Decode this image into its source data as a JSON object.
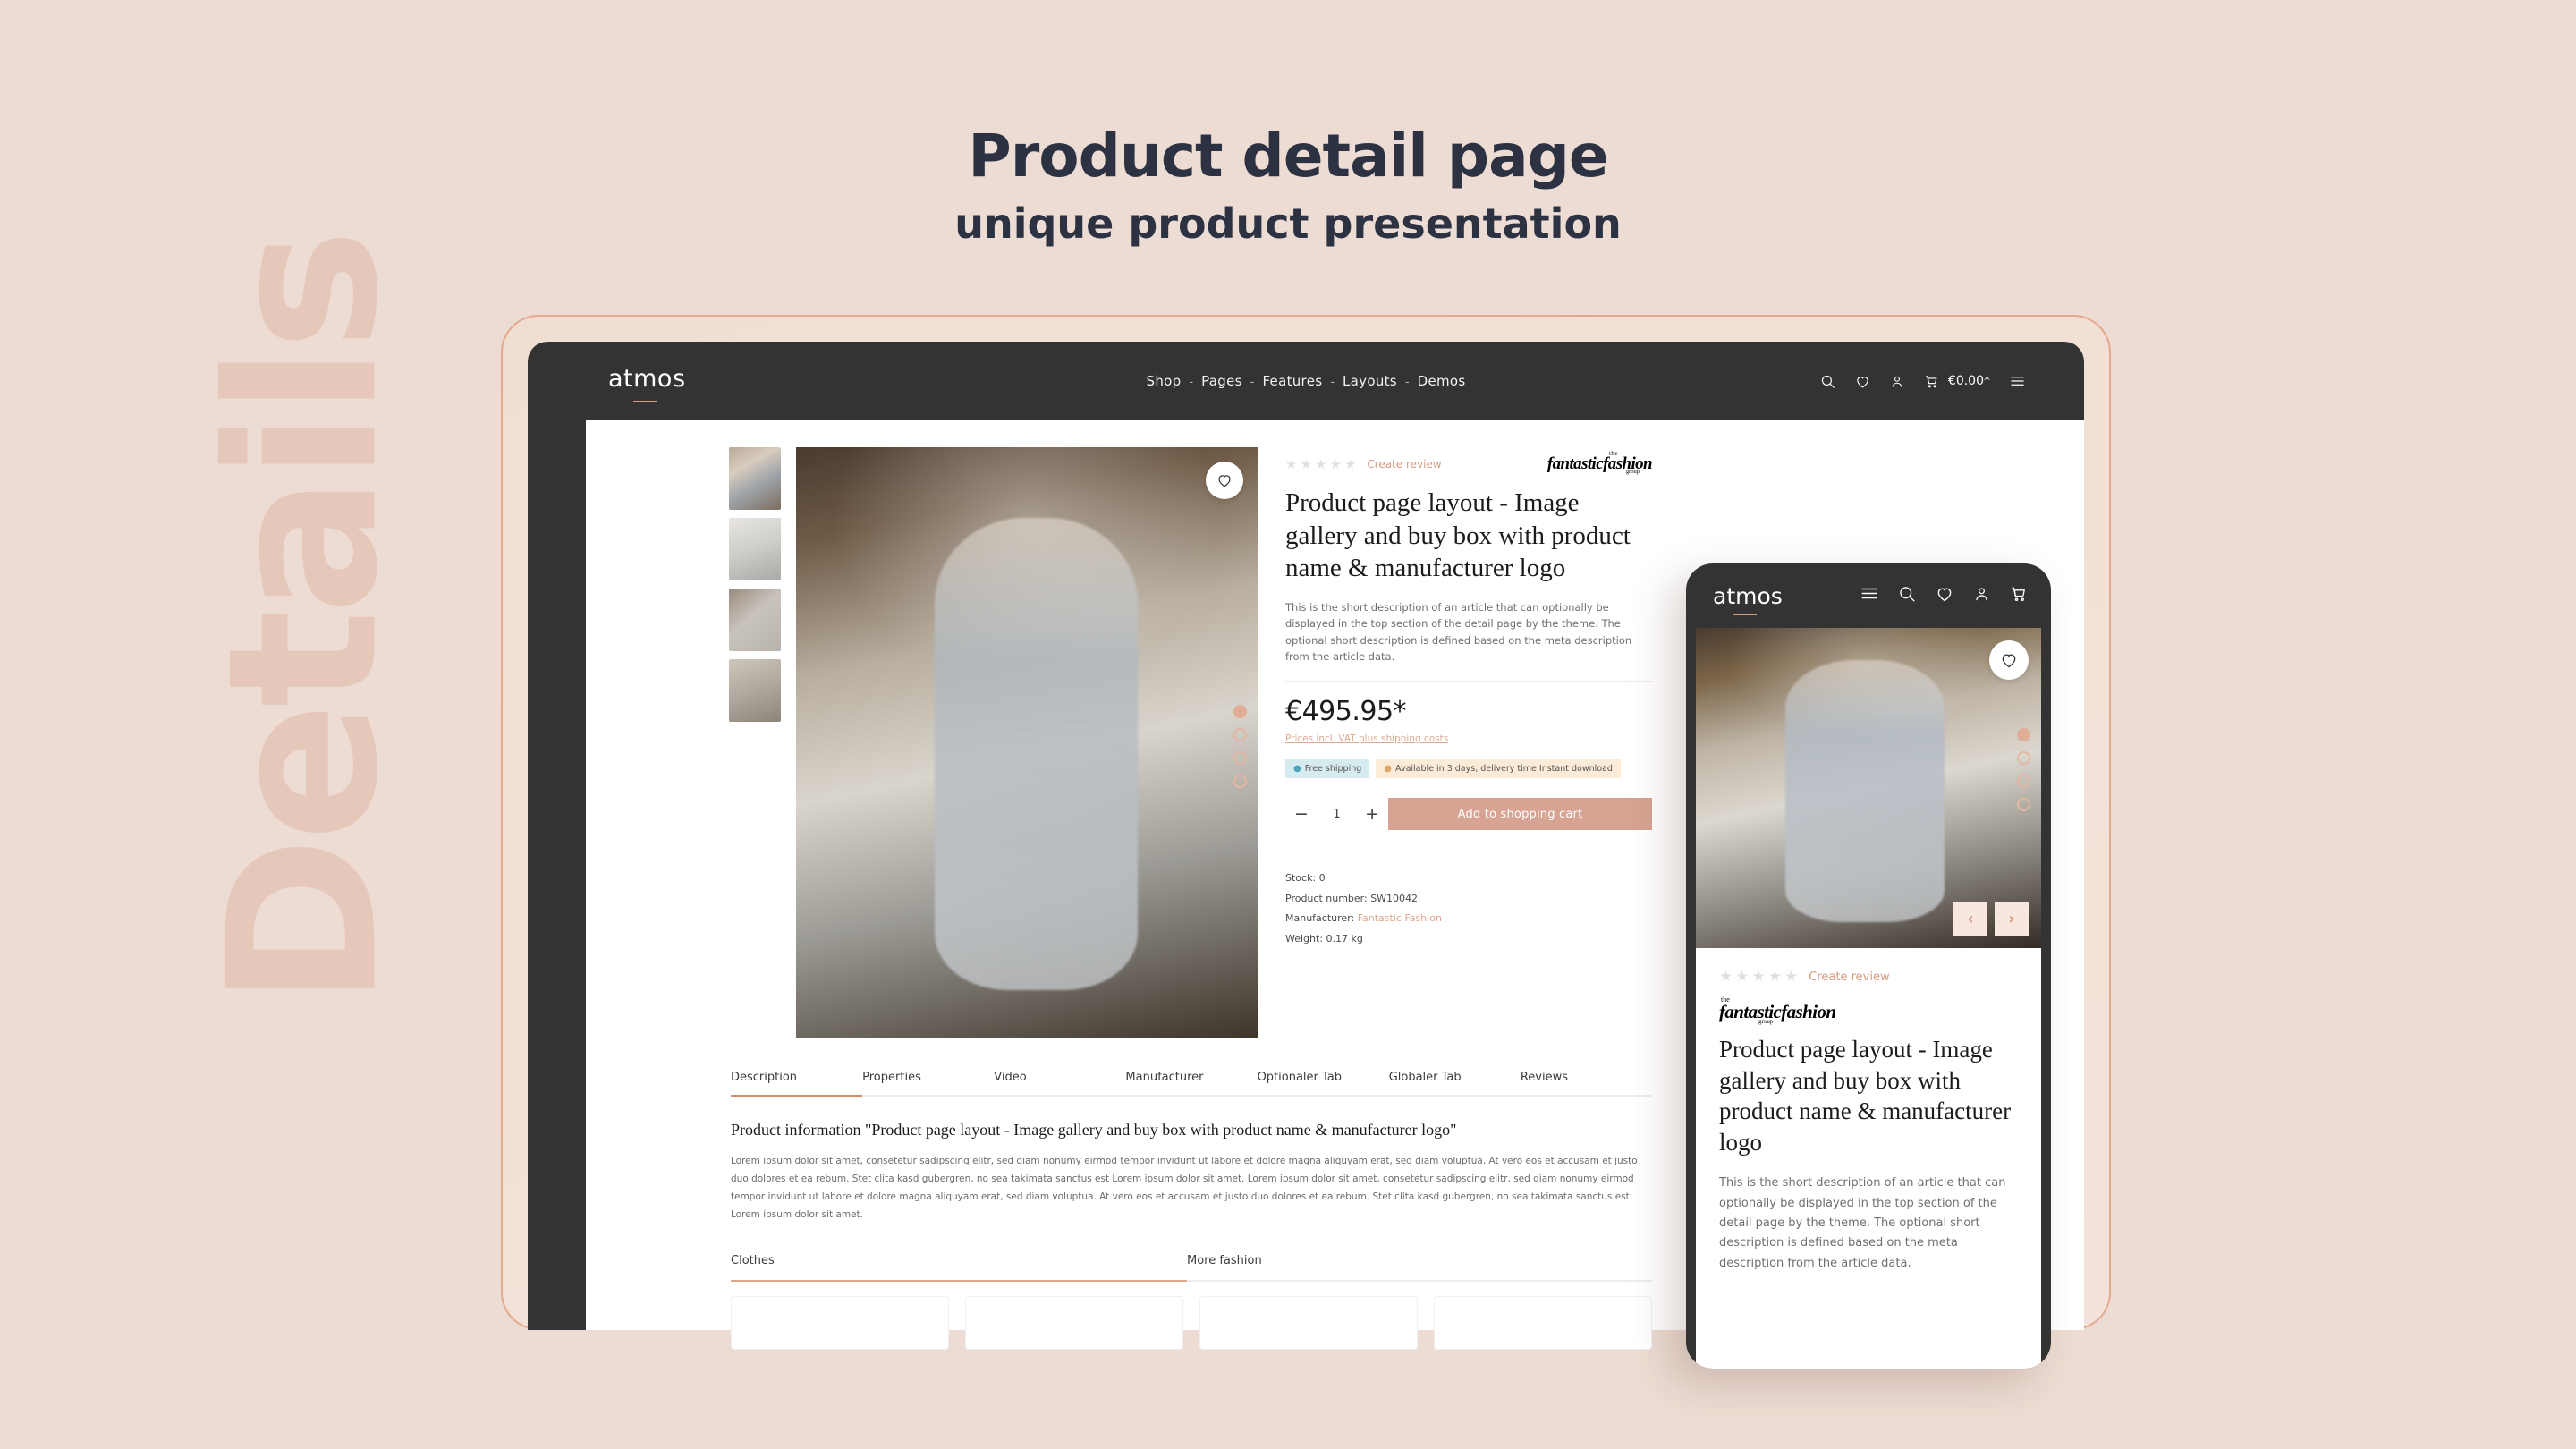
{
  "heading": {
    "title": "Product detail page",
    "subtitle": "unique product presentation"
  },
  "background_word": "Details",
  "colors": {
    "page_background": "#EDDCD3",
    "accent": "#D7A392",
    "dark_chrome": "#333333",
    "link": "#DCA98F",
    "heading_text": "#2C3242"
  },
  "tablet": {
    "brand": "atmos",
    "nav": [
      {
        "label": "Shop"
      },
      {
        "label": "Pages"
      },
      {
        "label": "Features"
      },
      {
        "label": "Layouts"
      },
      {
        "label": "Demos"
      }
    ],
    "nav_separator": "-",
    "actions": {
      "search_icon": "search-icon",
      "wishlist_icon": "heart-icon",
      "account_icon": "user-icon",
      "cart_icon": "cart-icon",
      "cart_total": "€0.00*",
      "menu_icon": "hamburger-icon"
    },
    "gallery": {
      "thumbnail_count": 4,
      "dots": 4,
      "active_dot": 1,
      "wishlist_icon": "heart-icon"
    },
    "buybox": {
      "rating_stars": 5,
      "rating_value": 0,
      "create_review": "Create review",
      "manufacturer_logo": {
        "line_top": "the",
        "line_main": "fantasticfashion",
        "line_bottom": "group"
      },
      "product_title": "Product page layout - Image gallery and buy box with product name & manufacturer logo",
      "short_description": "This is the short description of an article that can optionally be displayed in the top section of the detail page by the theme. The optional short description is defined based on the meta description from the article data.",
      "price": "€495.95*",
      "vat_note": "Prices incl. VAT plus shipping costs",
      "badges": [
        {
          "label": "Free shipping",
          "type": "shipping"
        },
        {
          "label": "Available in 3 days, delivery time Instant download",
          "type": "availability"
        }
      ],
      "quantity": {
        "decrease": "−",
        "value": "1",
        "increase": "+"
      },
      "add_to_cart": "Add to shopping cart",
      "meta": {
        "stock": "Stock: 0",
        "product_number": "Product number: SW10042",
        "manufacturer_label": "Manufacturer:",
        "manufacturer_value": "Fantastic Fashion",
        "weight": "Weight: 0.17 kg"
      }
    },
    "tabs": [
      {
        "label": "Description",
        "active": true
      },
      {
        "label": "Properties",
        "active": false
      },
      {
        "label": "Video",
        "active": false
      },
      {
        "label": "Manufacturer",
        "active": false
      },
      {
        "label": "Optionaler Tab",
        "active": false
      },
      {
        "label": "Globaler Tab",
        "active": false
      },
      {
        "label": "Reviews",
        "active": false
      }
    ],
    "description": {
      "heading": "Product information \"Product page layout - Image gallery and buy box with product name & manufacturer logo\"",
      "body": "Lorem ipsum dolor sit amet, consetetur sadipscing elitr, sed diam nonumy eirmod tempor invidunt ut labore et dolore magna aliquyam erat, sed diam voluptua. At vero eos et accusam et justo duo dolores et ea rebum. Stet clita kasd gubergren, no sea takimata sanctus est Lorem ipsum dolor sit amet. Lorem ipsum dolor sit amet, consetetur sadipscing elitr, sed diam nonumy eirmod tempor invidunt ut labore et dolore magna aliquyam erat, sed diam voluptua. At vero eos et accusam et justo duo dolores et ea rebum. Stet clita kasd gubergren, no sea takimata sanctus est Lorem ipsum dolor sit amet."
    },
    "cross_tabs": [
      {
        "label": "Clothes",
        "active": true
      },
      {
        "label": "More fashion",
        "active": false
      }
    ],
    "card_count": 4
  },
  "phone": {
    "brand": "atmos",
    "icons": {
      "menu_icon": "hamburger-icon",
      "search_icon": "search-icon",
      "wishlist_icon": "heart-icon",
      "account_icon": "user-icon",
      "cart_icon": "cart-icon"
    },
    "gallery": {
      "dots": 4,
      "active_dot": 1,
      "prev_arrow": "‹",
      "next_arrow": "›",
      "wishlist_icon": "heart-icon"
    },
    "rating_stars": 5,
    "create_review": "Create review",
    "manufacturer_logo": {
      "line_top": "the",
      "line_main": "fantasticfashion",
      "line_bottom": "group"
    },
    "product_title": "Product page layout - Image gallery and buy box with product name & manufacturer logo",
    "short_description": "This is the short description of an article that can optionally be displayed in the top section of the detail page by the theme. The optional short description is defined based on the meta description from the article data."
  }
}
